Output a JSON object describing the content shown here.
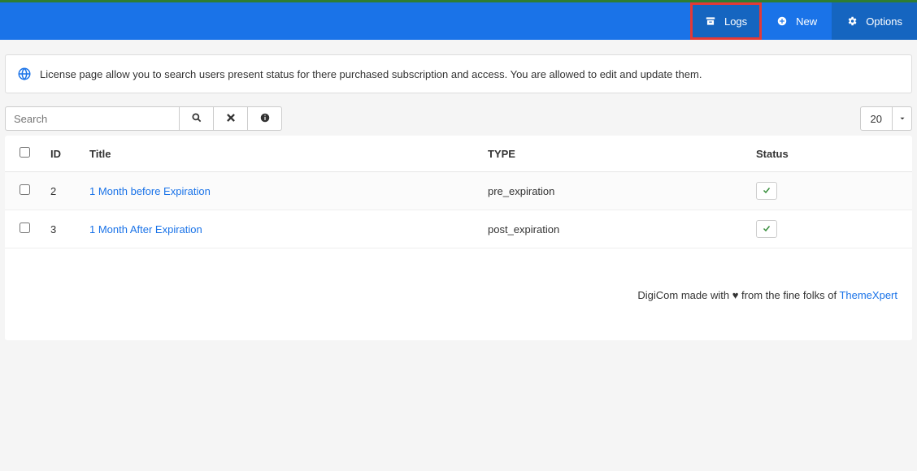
{
  "topbar": {
    "logs": "Logs",
    "new": "New",
    "options": "Options"
  },
  "info": {
    "text": "License page allow you to search users present status for there purchased subscription and access. You are allowed to edit and update them."
  },
  "search": {
    "placeholder": "Search"
  },
  "page_size": "20",
  "table": {
    "headers": {
      "id": "ID",
      "title": "Title",
      "type": "TYPE",
      "status": "Status"
    },
    "rows": [
      {
        "id": "2",
        "title": "1 Month before Expiration",
        "type": "pre_expiration"
      },
      {
        "id": "3",
        "title": "1 Month After Expiration",
        "type": "post_expiration"
      }
    ]
  },
  "footer": {
    "prefix": "DigiCom made with ♥ from the fine folks of ",
    "link": "ThemeXpert"
  }
}
